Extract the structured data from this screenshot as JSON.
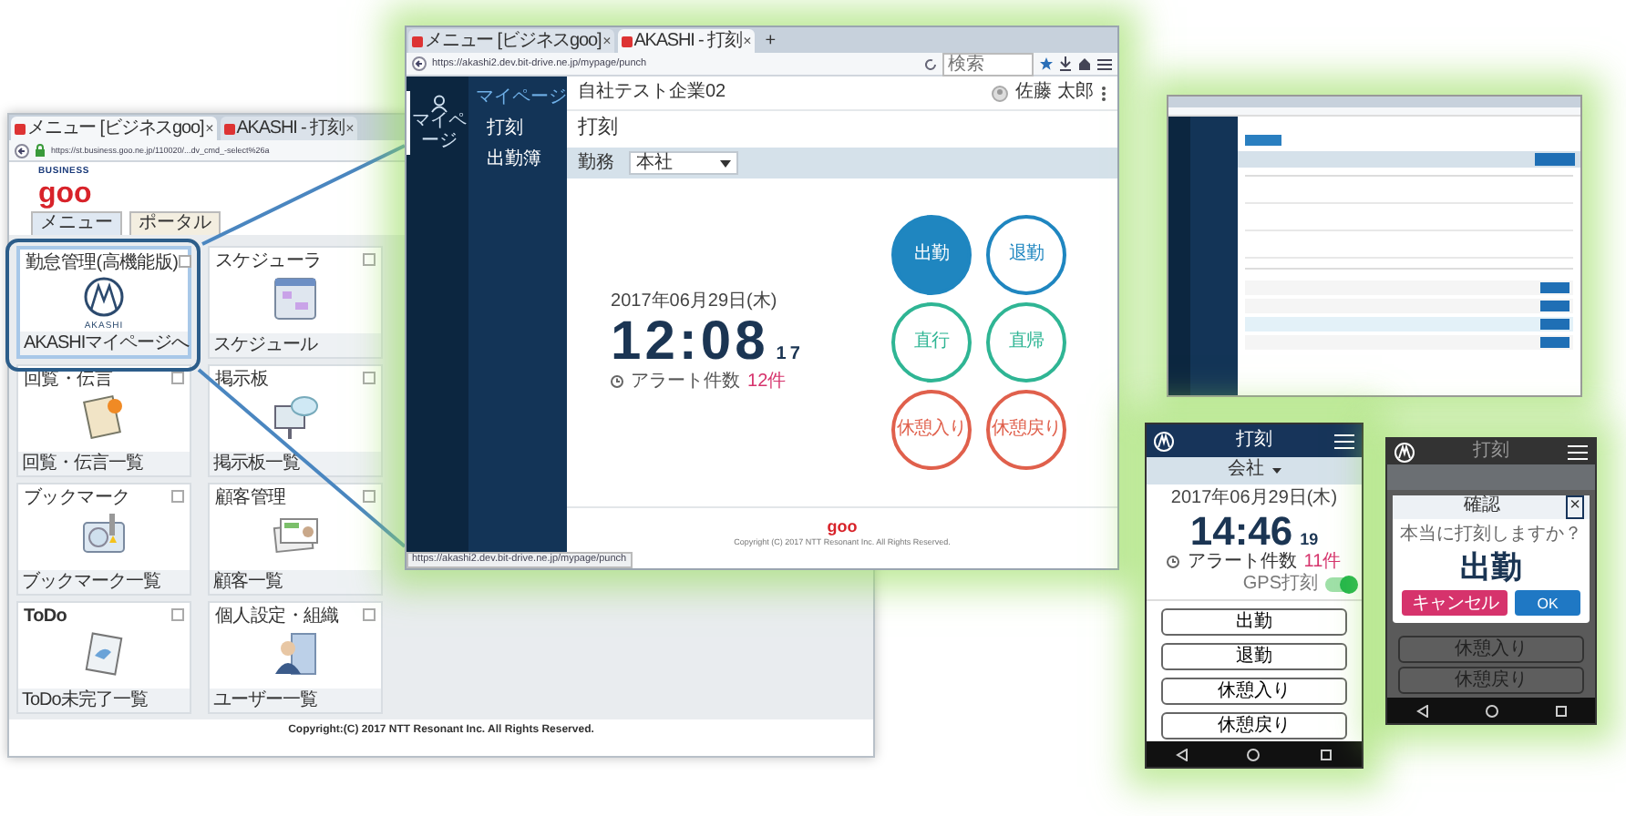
{
  "menu_window": {
    "tabs": [
      {
        "label": "メニュー [ビジネスgoo]",
        "close": "×",
        "selected": true
      },
      {
        "label": "AKASHI - 打刻",
        "close": "×",
        "selected": false
      }
    ],
    "url": "https://st.business.goo.ne.jp/110020/...dv_cmd_-select%26a",
    "logo": {
      "top": "BUSINESS",
      "main": "goo"
    },
    "menu_tabs": [
      {
        "label": "メニュー",
        "selected": true
      },
      {
        "label": "ポータル",
        "selected": false
      }
    ],
    "tiles": [
      {
        "title": "勤怠管理(高機能版)",
        "caption": "AKASHIマイページへ",
        "kind": "akashi",
        "logo_text": "AKASHI",
        "selected": true,
        "checked": false
      },
      {
        "title": "スケジューラ",
        "caption": "スケジュール",
        "kind": "calendar",
        "selected": false,
        "checked": false
      },
      {
        "title": "回覧・伝言",
        "caption": "回覧・伝言一覧",
        "kind": "memo",
        "selected": false,
        "checked": false
      },
      {
        "title": "掲示板",
        "caption": "掲示板一覧",
        "kind": "board",
        "selected": false,
        "checked": false
      },
      {
        "title": "ブックマーク",
        "caption": "ブックマーク一覧",
        "kind": "bookmark",
        "selected": false,
        "checked": false
      },
      {
        "title": "顧客管理",
        "caption": "顧客一覧",
        "kind": "card",
        "selected": false,
        "checked": false
      },
      {
        "title": "ToDo",
        "caption": "ToDo未完了一覧",
        "kind": "todo",
        "selected": false,
        "checked": false
      },
      {
        "title": "個人設定・組織",
        "caption": "ユーザー一覧",
        "kind": "person",
        "selected": false,
        "checked": false
      }
    ],
    "copyright": "Copyright:(C) 2017 NTT Resonant Inc. All Rights Reserved."
  },
  "punch_window": {
    "tabs": [
      {
        "label": "メニュー [ビジネスgoo]",
        "close": "×",
        "selected": false
      },
      {
        "label": "AKASHI - 打刻",
        "close": "×",
        "selected": true
      }
    ],
    "new_tab": "+",
    "url": "https://akashi2.dev.bit-drive.ne.jp/mypage/punch",
    "search_placeholder": "検索",
    "sidebar": {
      "nav": [
        {
          "label": "マイページ",
          "selected": true
        }
      ],
      "menu": [
        {
          "label": "マイページ",
          "kind": "heading"
        },
        {
          "label": "打刻",
          "kind": "item"
        },
        {
          "label": "出勤簿",
          "kind": "item"
        }
      ]
    },
    "company": "自社テスト企業02",
    "user": "佐藤 太郎",
    "title": "打刻",
    "filter": {
      "label": "勤務",
      "value": "本社"
    },
    "date": "2017年06月29日(木)",
    "time": "12:08",
    "seconds": "17",
    "alert_label": "アラート件数",
    "alert_count": "12件",
    "buttons": [
      {
        "label": "出勤",
        "color": "#1f86c0",
        "selected": true
      },
      {
        "label": "退勤",
        "color": "#1f86c0",
        "selected": false
      },
      {
        "label": "直行",
        "color": "#2fb594",
        "selected": false
      },
      {
        "label": "直帰",
        "color": "#2fb594",
        "selected": false
      },
      {
        "label": "休憩入り",
        "color": "#e0604c",
        "selected": false
      },
      {
        "label": "休憩戻り",
        "color": "#e0604c",
        "selected": false
      }
    ],
    "footer_logo": "goo",
    "copyright": "Copyright (C) 2017 NTT Resonant Inc. All Rights Reserved.",
    "status_url": "https://akashi2.dev.bit-drive.ne.jp/mypage/punch"
  },
  "phone_punch": {
    "title": "打刻",
    "location": "会社",
    "date": "2017年06月29日(木)",
    "time": "14:46",
    "seconds": "19",
    "alert_label": "アラート件数",
    "alert_count": "11件",
    "gps_label": "GPS打刻",
    "gps_on": true,
    "buttons": [
      "出勤",
      "退勤",
      "休憩入り",
      "休憩戻り"
    ]
  },
  "phone_confirm": {
    "title": "打刻",
    "buttons": [
      "休憩入り",
      "休憩戻り"
    ],
    "dialog": {
      "title": "確認",
      "close": "×",
      "message": "本当に打刻しますか？",
      "action": "出勤",
      "cancel": "キャンセル",
      "ok": "OK"
    }
  }
}
